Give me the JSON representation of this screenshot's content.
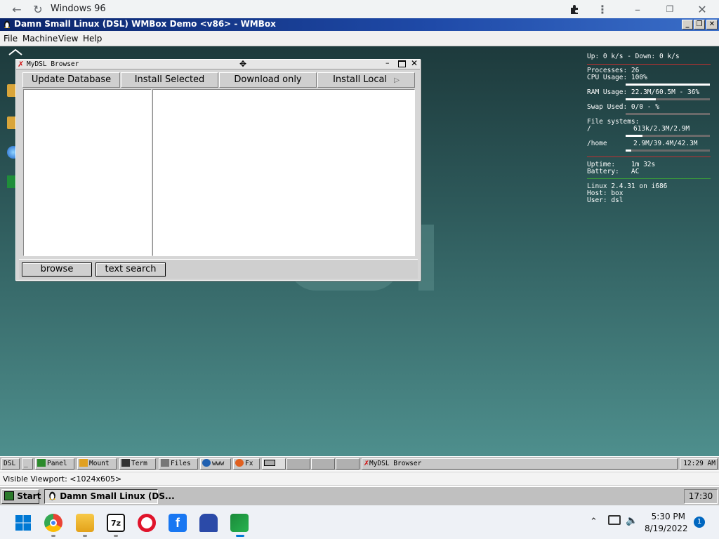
{
  "browser": {
    "title": "Windows 96",
    "icons": [
      "back-arrow-icon",
      "reload-icon",
      "extensions-icon",
      "more-menu-icon",
      "minimize-icon",
      "restore-icon",
      "close-icon"
    ]
  },
  "vm": {
    "title": "Damn Small Linux (DSL) WMBox Demo <v86> - WMBox",
    "menu": [
      "File",
      "Machine",
      "View",
      "Help"
    ]
  },
  "sysmon": {
    "net": "Up: 0 k/s - Down: 0 k/s",
    "processes": "Processes: 26",
    "cpu": "CPU Usage: 100%",
    "ram": "RAM Usage: 22.3M/60.5M - 36%",
    "swap": "Swap Used: 0/0 - %",
    "fs_header": "File systems:",
    "fs_root_name": "/",
    "fs_root_val": "613k/2.3M/2.9M",
    "fs_home_name": "/home",
    "fs_home_val": "2.9M/39.4M/42.3M",
    "uptime": "Uptime:    1m 32s",
    "battery": "Battery:   AC",
    "kernel": "Linux 2.4.31 on i686",
    "host": "Host: box",
    "user": "User: dsl",
    "cpu_fraction": 1.0,
    "ram_fraction": 0.36,
    "swap_fraction": 0.0,
    "root_fraction": 0.2,
    "home_fraction": 0.07
  },
  "mydsl": {
    "title": "MyDSL Browser",
    "tabs": [
      "Update Database",
      "Install Selected",
      "Download only",
      "Install Local"
    ],
    "buttons": [
      "browse",
      "text search"
    ]
  },
  "dsl_taskbar": {
    "items": [
      "DSL",
      "_",
      "Panel",
      "Mount",
      "Term",
      "Files",
      "www",
      "Fx"
    ],
    "task": "MyDSL Browser",
    "clock": "12:29 AM"
  },
  "viewport": {
    "label": "Visible Viewport: <1024x605>"
  },
  "w96": {
    "start": "Start",
    "task": "Damn Small Linux (DS...",
    "clock": "17:30"
  },
  "win11": {
    "apps": [
      "windows-start-icon",
      "chrome-icon",
      "file-explorer-icon",
      "7zip-icon",
      "opera-icon",
      "facebook-icon",
      "game-icon",
      "windows96-icon"
    ],
    "time": "5:30 PM",
    "date": "8/19/2022",
    "notifications": "1"
  }
}
